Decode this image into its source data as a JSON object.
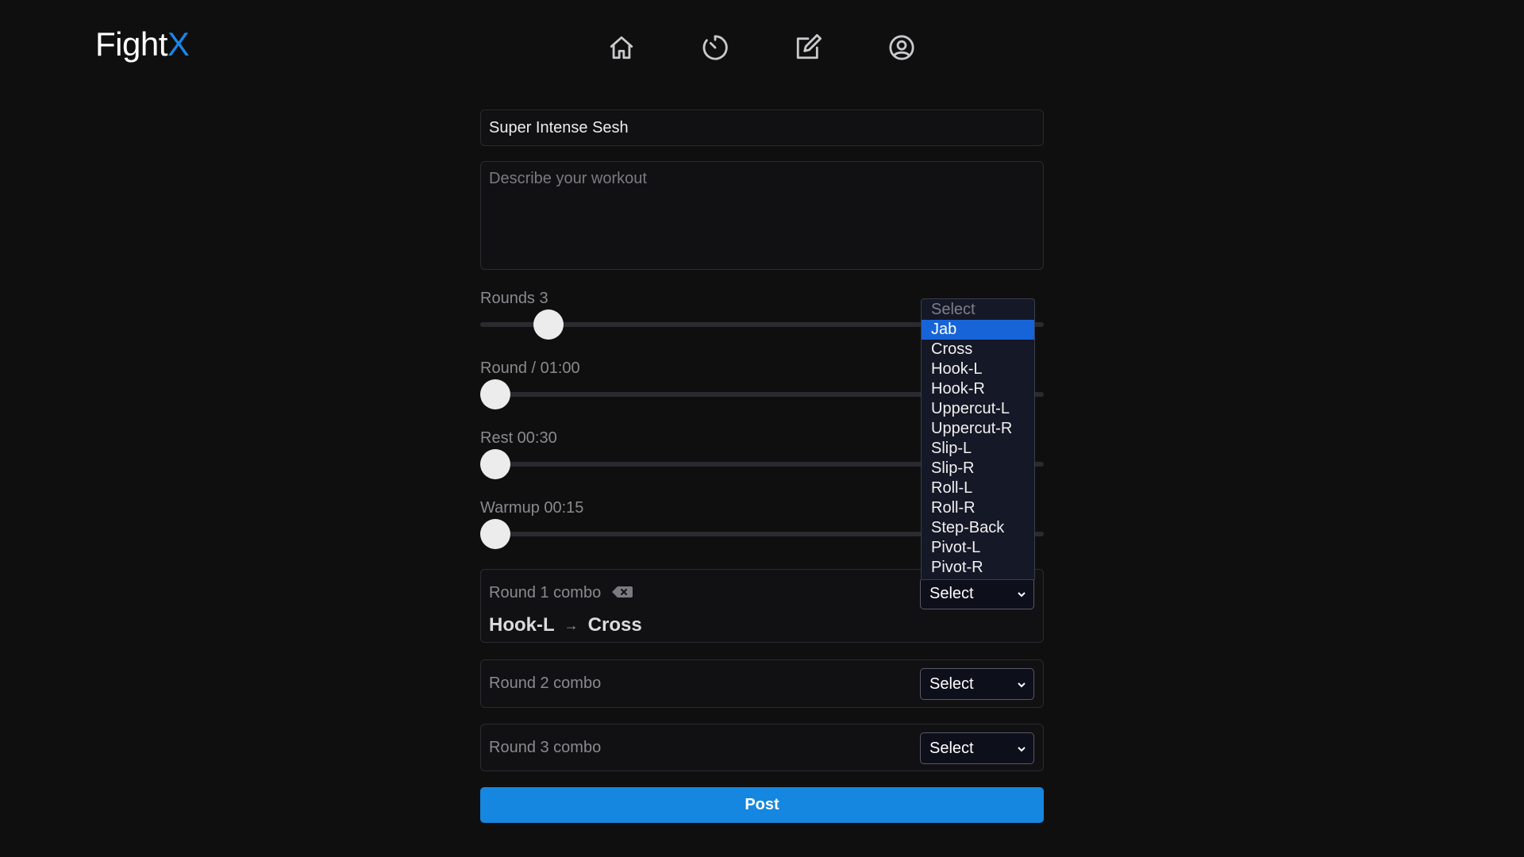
{
  "app": {
    "logo_text": "Fight",
    "logo_accent": "X",
    "accent_color": "#1a86e8"
  },
  "nav": {
    "icons": [
      "home-icon",
      "timer-icon",
      "edit-icon",
      "profile-icon"
    ]
  },
  "form": {
    "title_value": "Super Intense Sesh",
    "description_placeholder": "Describe your workout",
    "sliders": [
      {
        "label": "Rounds 3",
        "value": 3,
        "fraction": 0.1
      },
      {
        "label": "Round / 01:00",
        "value": "01:00",
        "fraction": 0.0
      },
      {
        "label": "Rest 00:30",
        "value": "00:30",
        "fraction": 0.0
      },
      {
        "label": "Warmup 00:15",
        "value": "00:15",
        "fraction": 0.0
      }
    ],
    "combos": [
      {
        "label": "Round 1 combo",
        "moves": [
          "Hook-L",
          "Cross"
        ],
        "select": "Select"
      },
      {
        "label": "Round 2 combo",
        "moves": [],
        "select": "Select"
      },
      {
        "label": "Round 3 combo",
        "moves": [],
        "select": "Select"
      }
    ],
    "post_label": "Post"
  },
  "dropdown": {
    "placeholder": "Select",
    "highlighted": "Jab",
    "options": [
      "Jab",
      "Cross",
      "Hook-L",
      "Hook-R",
      "Uppercut-L",
      "Uppercut-R",
      "Slip-L",
      "Slip-R",
      "Roll-L",
      "Roll-R",
      "Step-Back",
      "Pivot-L",
      "Pivot-R"
    ]
  },
  "colors": {
    "background": "#0f0f10",
    "primary_button": "#1587e0",
    "dropdown_highlight": "#1764d8"
  }
}
